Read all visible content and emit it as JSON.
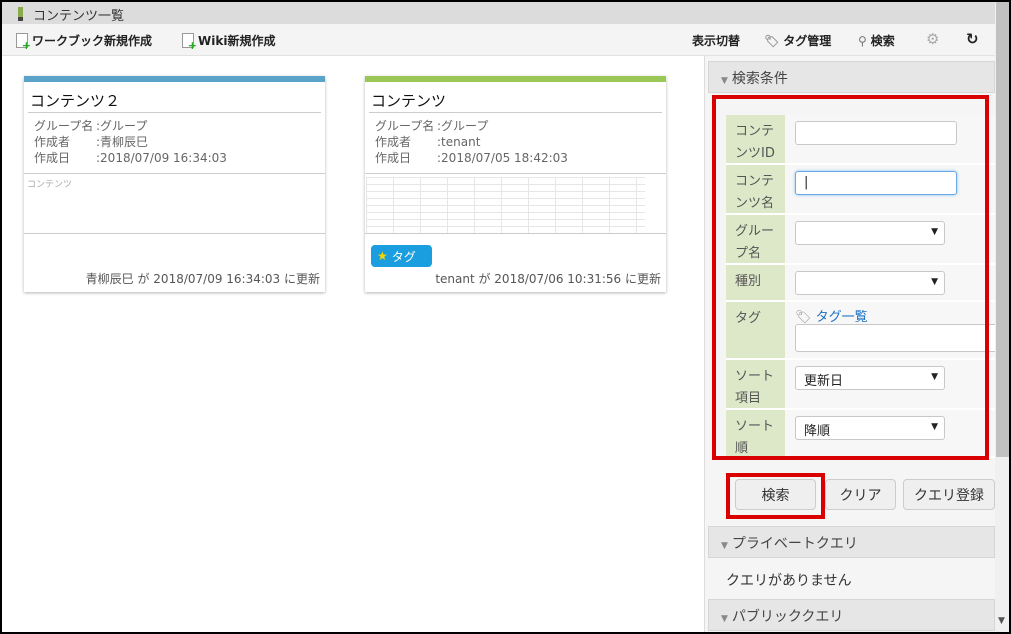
{
  "window": {
    "title": "コンテンツ一覧"
  },
  "toolbar": {
    "new_workbook": "ワークブック新規作成",
    "new_wiki": "Wiki新規作成",
    "view_toggle": "表示切替",
    "tag_manage": "タグ管理",
    "search": "検索"
  },
  "cards": [
    {
      "title": "コンテンツ２",
      "group_label": "グループ名",
      "group": "グループ",
      "author_label": "作成者",
      "author": "青柳辰巳",
      "created_label": "作成日",
      "created": "2018/07/09 16:34:03",
      "preview_text": "コンテンツ",
      "updated": "青柳辰巳 が 2018/07/09 16:34:03 に更新",
      "accent": "#5ba3c9"
    },
    {
      "title": "コンテンツ",
      "group_label": "グループ名",
      "group": "グループ",
      "author_label": "作成者",
      "author": "tenant",
      "created_label": "作成日",
      "created": "2018/07/05 18:42:03",
      "tag": "タグ",
      "updated": "tenant が 2018/07/06 10:31:56 に更新",
      "accent": "#9bc756"
    }
  ],
  "search_panel": {
    "header": "検索条件",
    "fields": {
      "content_id": "コンテンツID",
      "content_name": "コンテンツ名",
      "group_name": "グループ名",
      "type": "種別",
      "tag": "タグ",
      "tag_list": "タグ一覧",
      "sort_item": "ソート項目",
      "sort_item_value": "更新日",
      "sort_order": "ソート順",
      "sort_order_value": "降順"
    },
    "buttons": {
      "search": "検索",
      "clear": "クリア",
      "save_query": "クエリ登録"
    },
    "private_header": "プライベートクエリ",
    "no_query": "クエリがありません",
    "public_header": "パブリッククエリ"
  }
}
